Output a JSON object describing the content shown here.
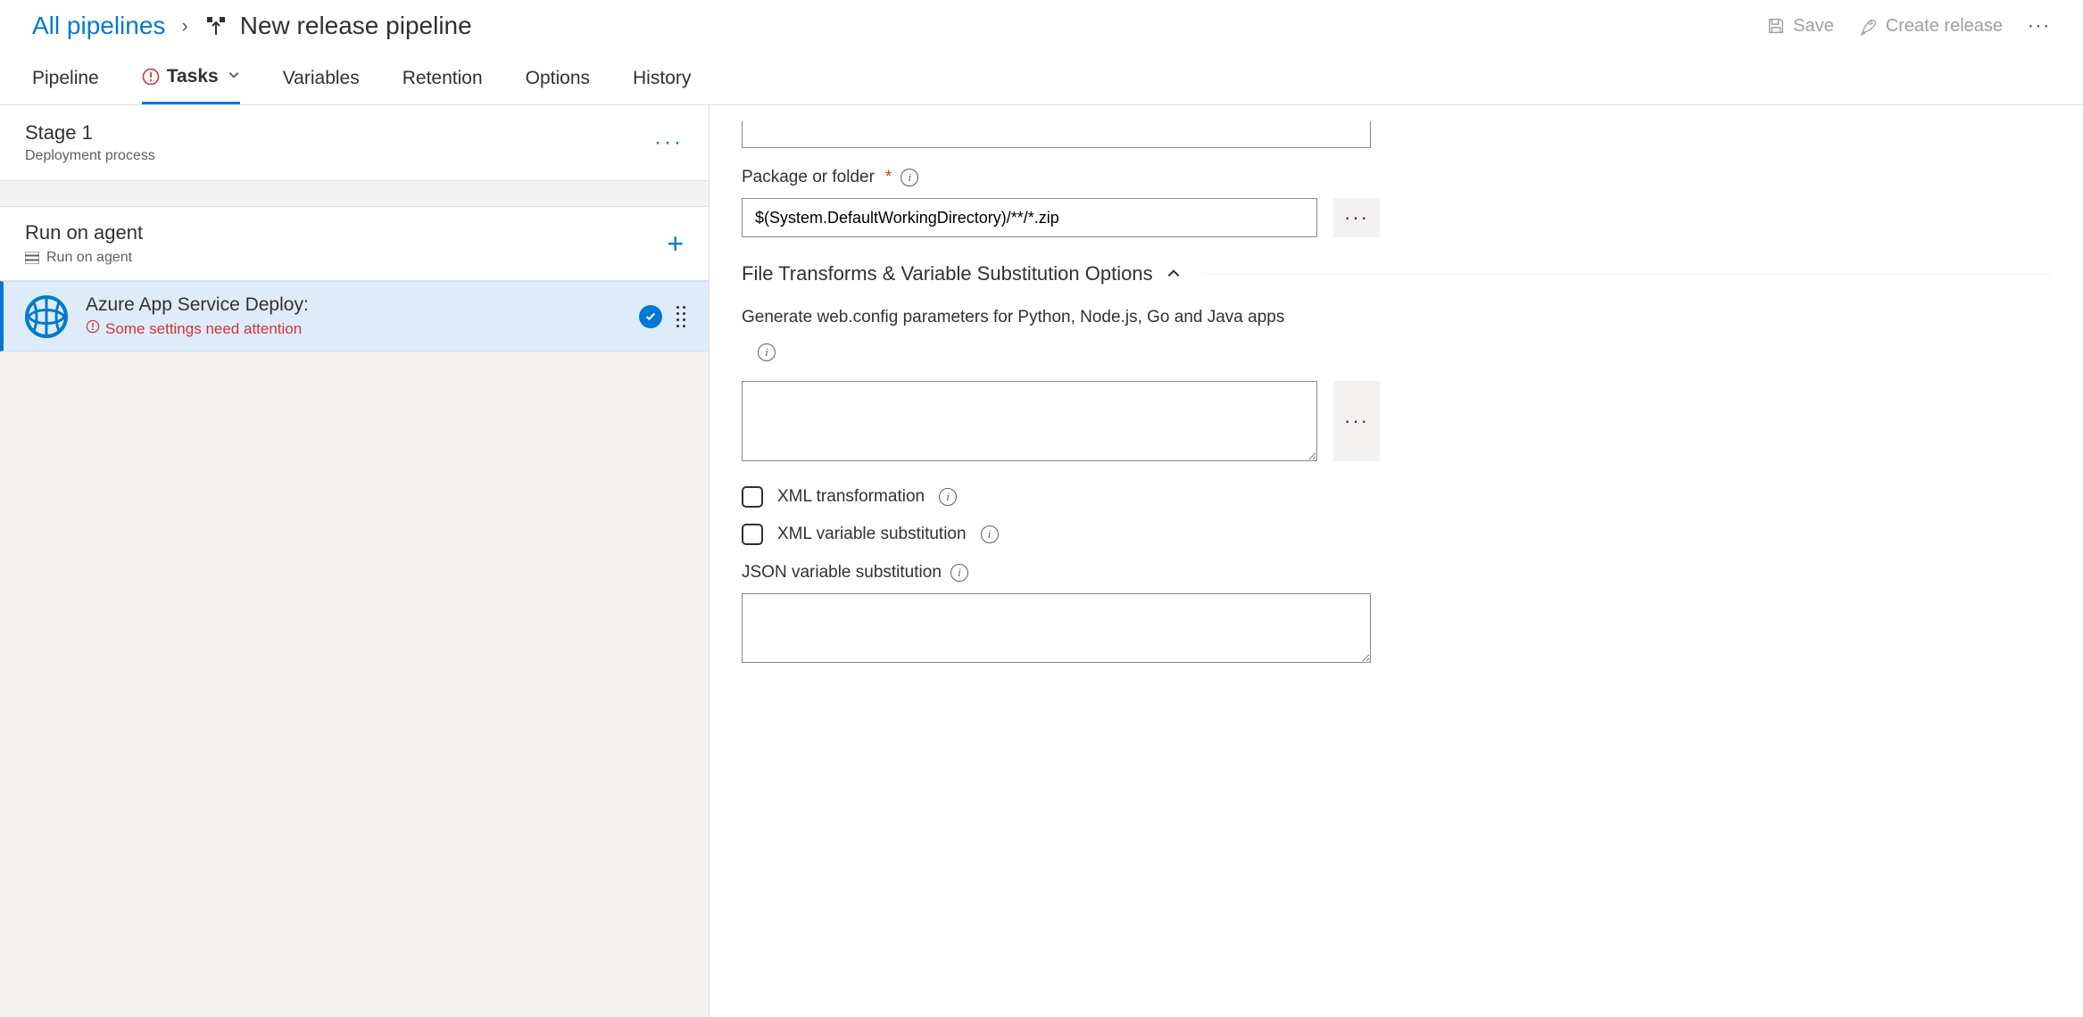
{
  "breadcrumb": {
    "root": "All pipelines",
    "title": "New release pipeline"
  },
  "headerActions": {
    "save": "Save",
    "createRelease": "Create release"
  },
  "tabs": {
    "pipeline": "Pipeline",
    "tasks": "Tasks",
    "variables": "Variables",
    "retention": "Retention",
    "options": "Options",
    "history": "History"
  },
  "leftPane": {
    "stage": {
      "title": "Stage 1",
      "subtitle": "Deployment process"
    },
    "agent": {
      "title": "Run on agent",
      "subtitle": "Run on agent"
    },
    "task": {
      "title": "Azure App Service Deploy:",
      "warning": "Some settings need attention"
    }
  },
  "form": {
    "packageLabel": "Package or folder",
    "packageValue": "$(System.DefaultWorkingDirectory)/**/*.zip",
    "sectionTitle": "File Transforms & Variable Substitution Options",
    "webConfigLabel": "Generate web.config parameters for Python, Node.js, Go and Java apps",
    "webConfigValue": "",
    "xmlTransform": "XML transformation",
    "xmlVarSub": "XML variable substitution",
    "jsonVarSub": "JSON variable substitution",
    "jsonVarSubValue": ""
  }
}
